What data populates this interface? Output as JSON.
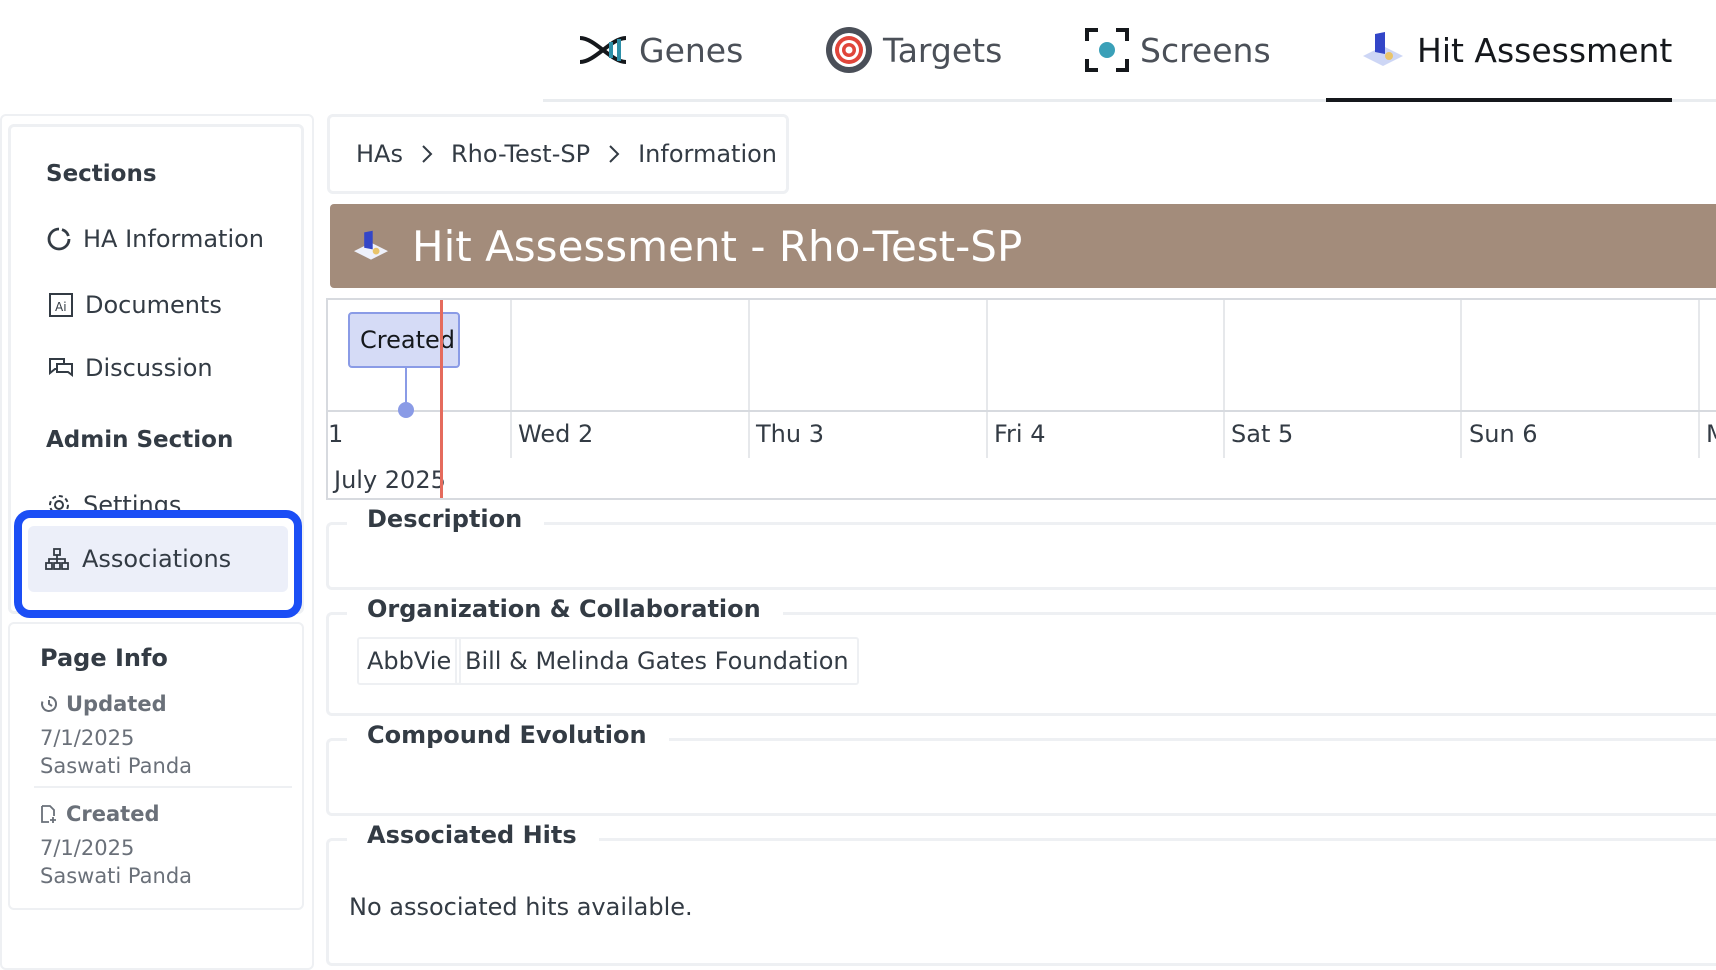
{
  "topnav": {
    "tabs": [
      {
        "label": "Genes",
        "icon": "dna-icon"
      },
      {
        "label": "Targets",
        "icon": "target-icon"
      },
      {
        "label": "Screens",
        "icon": "screen-focus-icon"
      },
      {
        "label": "Hit Assessment",
        "icon": "hit-assessment-icon",
        "active": true
      }
    ]
  },
  "sidebar": {
    "sections_heading": "Sections",
    "items": [
      {
        "label": "HA Information",
        "icon": "circle-icon"
      },
      {
        "label": "Documents",
        "icon": "document-ai-icon"
      },
      {
        "label": "Discussion",
        "icon": "chat-icon"
      }
    ],
    "admin_heading": "Admin Section",
    "admin_items": [
      {
        "label": "Settings",
        "icon": "gear-icon"
      },
      {
        "label": "Associations",
        "icon": "sitemap-icon",
        "selected": true
      }
    ]
  },
  "page_info": {
    "title": "Page Info",
    "updated_label": "Updated",
    "updated_date": "7/1/2025",
    "updated_by": "Saswati Panda",
    "created_label": "Created",
    "created_date": "7/1/2025",
    "created_by": "Saswati Panda"
  },
  "breadcrumb": [
    "HAs",
    "Rho-Test-SP",
    "Information"
  ],
  "header": {
    "title": "Hit Assessment - Rho-Test-SP",
    "color": "#a38c7b"
  },
  "timeline": {
    "event_label": "Created",
    "days": [
      "1",
      "Wed 2",
      "Thu 3",
      "Fri 4",
      "Sat 5",
      "Sun 6",
      "M"
    ],
    "month": "July 2025"
  },
  "description": {
    "legend": "Description"
  },
  "organization": {
    "legend": "Organization & Collaboration",
    "orgs": [
      "AbbVie",
      "Bill & Melinda Gates Foundation"
    ]
  },
  "compound_evolution": {
    "legend": "Compound Evolution"
  },
  "associated_hits": {
    "legend": "Associated Hits",
    "empty_message": "No associated hits available."
  },
  "colors": {
    "highlight": "#1b4ef5",
    "timeline_now": "#e56b5d",
    "event_fill": "#d5dbf6"
  }
}
